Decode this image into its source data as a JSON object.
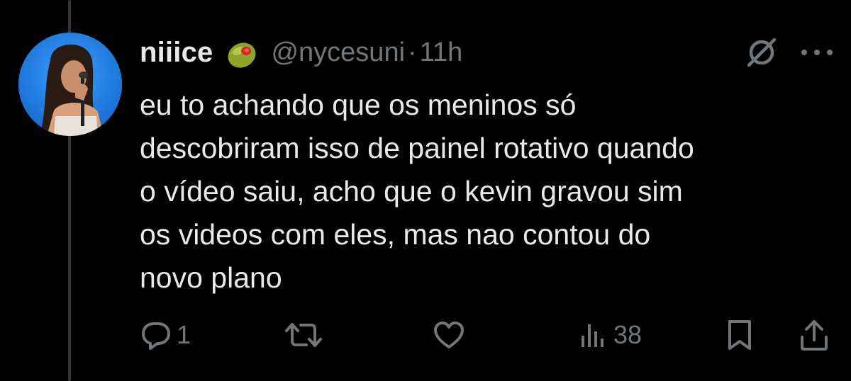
{
  "author": {
    "display_name": "niiice",
    "emoji_icon": "olive-emoji",
    "handle": "@nycesuni",
    "separator": "·",
    "time": "11h"
  },
  "tweet": {
    "text": "eu to achando que os meninos só\ndescobriram isso de painel rotativo quando\no vídeo saiu, acho que o kevin gravou sim\nos videos com eles, mas nao contou do\nnovo plano"
  },
  "actions": {
    "reply_count": "1",
    "retweet_count": "",
    "like_count": "",
    "views_count": "38"
  },
  "icons": {
    "reply": "reply-icon",
    "retweet": "retweet-icon",
    "like": "heart-icon",
    "views": "views-icon",
    "bookmark": "bookmark-icon",
    "share": "share-icon",
    "mute": "muted-icon",
    "more": "more-icon"
  },
  "colors": {
    "background": "#000000",
    "text": "#e7e9ea",
    "secondary": "#71767b",
    "thread_line": "#333639"
  }
}
